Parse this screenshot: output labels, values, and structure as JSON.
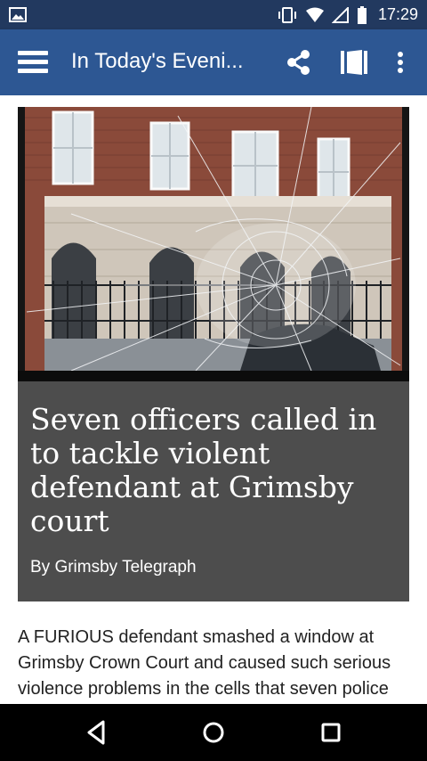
{
  "status_bar": {
    "time": "17:29",
    "icons": [
      "notification-image-icon",
      "vibrate-icon",
      "wifi-icon",
      "signal-icon",
      "battery-icon"
    ]
  },
  "app_bar": {
    "title": "In Today's Eveni...",
    "icons": [
      "menu-icon",
      "share-icon",
      "reader-view-icon",
      "more-vert-icon"
    ],
    "background": "#2d5793",
    "status_background": "#22395f"
  },
  "article": {
    "image_icon": "broken-window-photo",
    "headline": "Seven officers called in to tackle violent defendant at Grimsby court",
    "byline": "By Grimsby Telegraph",
    "body": "A FURIOUS defendant smashed a window at Grimsby Crown Court and caused such serious violence problems in the cells that seven police officers had to be called in to"
  },
  "nav_bar": {
    "icons": [
      "back-icon",
      "home-icon",
      "recents-icon"
    ]
  }
}
